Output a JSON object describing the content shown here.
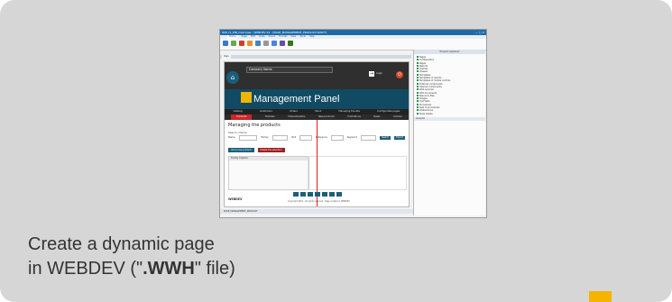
{
  "screenshot": {
    "window_title": "WW_IS_WB_Overview - WEBDEV 22 - [PAGE_MANAGEMENT_PRODUCT.WWH*]",
    "ribbon_tabs": [
      "Home",
      "Page",
      "Edit",
      "Code",
      "Insert",
      "Format",
      "View",
      "Tools",
      "Help"
    ],
    "document_tab": "Page",
    "document_tab_right": "Product explorer",
    "company_name": "Company Name",
    "login_label": "Login",
    "management_panel_title": "Management Panel",
    "menu_top": [
      "Catalog",
      "Customers",
      "Orders",
      "Stock",
      "Managing the site",
      "Configurable pages"
    ],
    "menu_bottom": [
      "Products",
      "Families",
      "Characteristics",
      "New products",
      "Promotions",
      "News",
      "Archive"
    ],
    "page_heading": "Managing the products",
    "search_criteria_label": "Search criteria",
    "filter": {
      "field1": "Name",
      "field2": "Family",
      "field3": "Unit",
      "field4": "Reference",
      "field5": "Keyword",
      "search_button": "Search",
      "export_button": "Export"
    },
    "actions": [
      "Add a new product",
      "Delete the selection"
    ],
    "family_caption": "Family Caption",
    "footer_copyright": "Copyright 2016 - All rights reserved - Page created in WEBDEV",
    "logo_text": "WEBDEV",
    "taskbar_text": "PAGE_MANAGEMENT_PRODUCT",
    "explorer_header": "Project explorer",
    "explorer_items": [
      "Pages",
      "Configuration",
      "Pages",
      "Reports",
      "Queries",
      "Classes",
      "Templates",
      "Templates of reports",
      "Templates of mobile controls",
      "External components",
      "Internal components",
      "Web services",
      "XML documents",
      "Resource files",
      "Images",
      "Unit tests",
      "Procedures",
      "Sets of procedures",
      "Webservices",
      "Style sheets"
    ],
    "explorer_footer_label": "Analysis"
  },
  "caption": {
    "line1": "Create a dynamic page",
    "line2_prefix": "in WEBDEV (\"",
    "line2_strong": ".WWH",
    "line2_suffix": "\" file)"
  },
  "colors": {
    "card_bg": "#d6d6d6",
    "accent": "#f5b400",
    "banner": "#114b63",
    "menu_active": "#c62828"
  }
}
